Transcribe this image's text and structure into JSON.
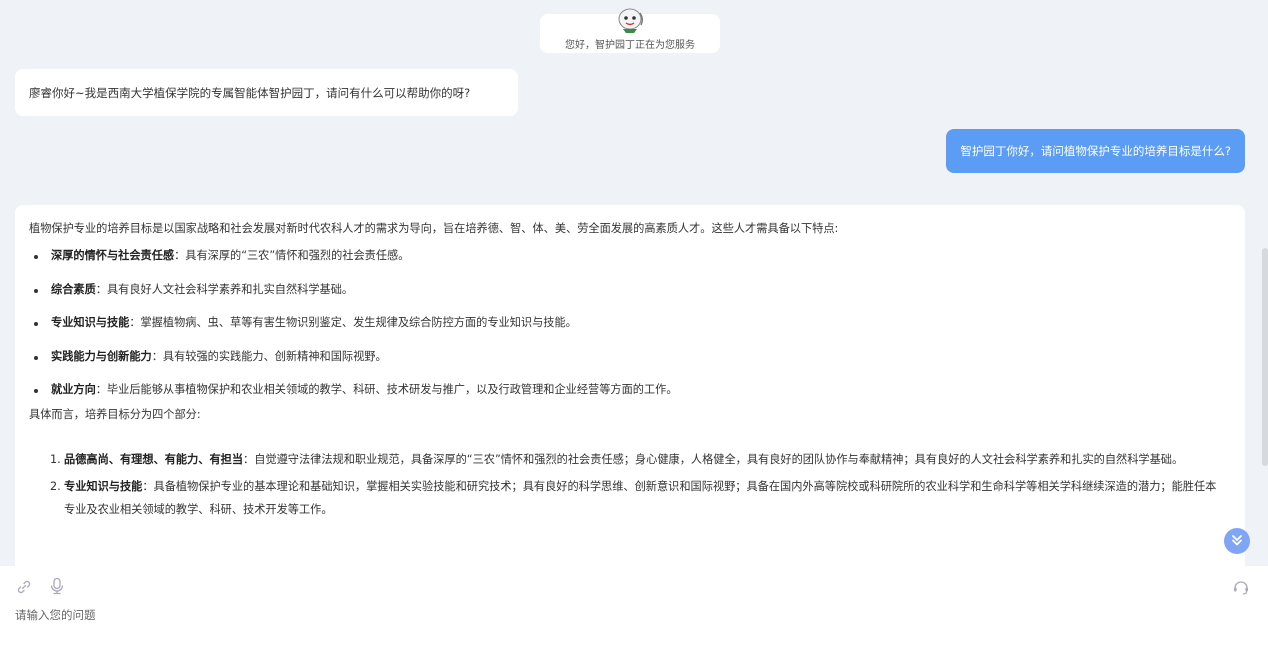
{
  "welcome": {
    "text": "您好，智护园丁正在为您服务",
    "avatar_icon": "robot-avatar-icon"
  },
  "bot_greeting": "廖睿你好~我是西南大学植保学院的专属智能体智护园丁，请问有什么可以帮助你的呀?",
  "user_question": "智护园丁你好，请问植物保护专业的培养目标是什么?",
  "answer": {
    "intro": "植物保护专业的培养目标是以国家战略和社会发展对新时代农科人才的需求为导向，旨在培养德、智、体、美、劳全面发展的高素质人才。这些人才需具备以下特点:",
    "bullets": [
      {
        "title": "深厚的情怀与社会责任感",
        "text": "：具有深厚的“三农”情怀和强烈的社会责任感。"
      },
      {
        "title": "综合素质",
        "text": "：具有良好人文社会科学素养和扎实自然科学基础。"
      },
      {
        "title": "专业知识与技能",
        "text": "：掌握植物病、虫、草等有害生物识别鉴定、发生规律及综合防控方面的专业知识与技能。"
      },
      {
        "title": "实践能力与创新能力",
        "text": "：具有较强的实践能力、创新精神和国际视野。"
      },
      {
        "title": "就业方向",
        "text": "：毕业后能够从事植物保护和农业相关领域的教学、科研、技术研发与推广，以及行政管理和企业经营等方面的工作。"
      }
    ],
    "subtitle": "具体而言，培养目标分为四个部分:",
    "numbered": [
      {
        "num": "1.",
        "title": "品德高尚、有理想、有能力、有担当",
        "text": "：自觉遵守法律法规和职业规范，具备深厚的“三农”情怀和强烈的社会责任感；身心健康，人格健全，具有良好的团队协作与奉献精神；具有良好的人文社会科学素养和扎实的自然科学基础。"
      },
      {
        "num": "2.",
        "title": "专业知识与技能",
        "text": "：具备植物保护专业的基本理论和基础知识，掌握相关实验技能和研究技术；具有良好的科学思维、创新意识和国际视野；具备在国内外高等院校或科研院所的农业科学和生命科学等相关学科继续深造的潜力；能胜任本专业及农业相关领域的教学、科研、技术开发等工作。"
      }
    ]
  },
  "input": {
    "placeholder": "请输入您的问题",
    "icons": [
      "link-icon",
      "microphone-icon",
      "headset-icon"
    ]
  },
  "colors": {
    "background": "#eff2f7",
    "user_bubble": "#5b9cf5",
    "scroll_button": "#7ea6f4"
  }
}
